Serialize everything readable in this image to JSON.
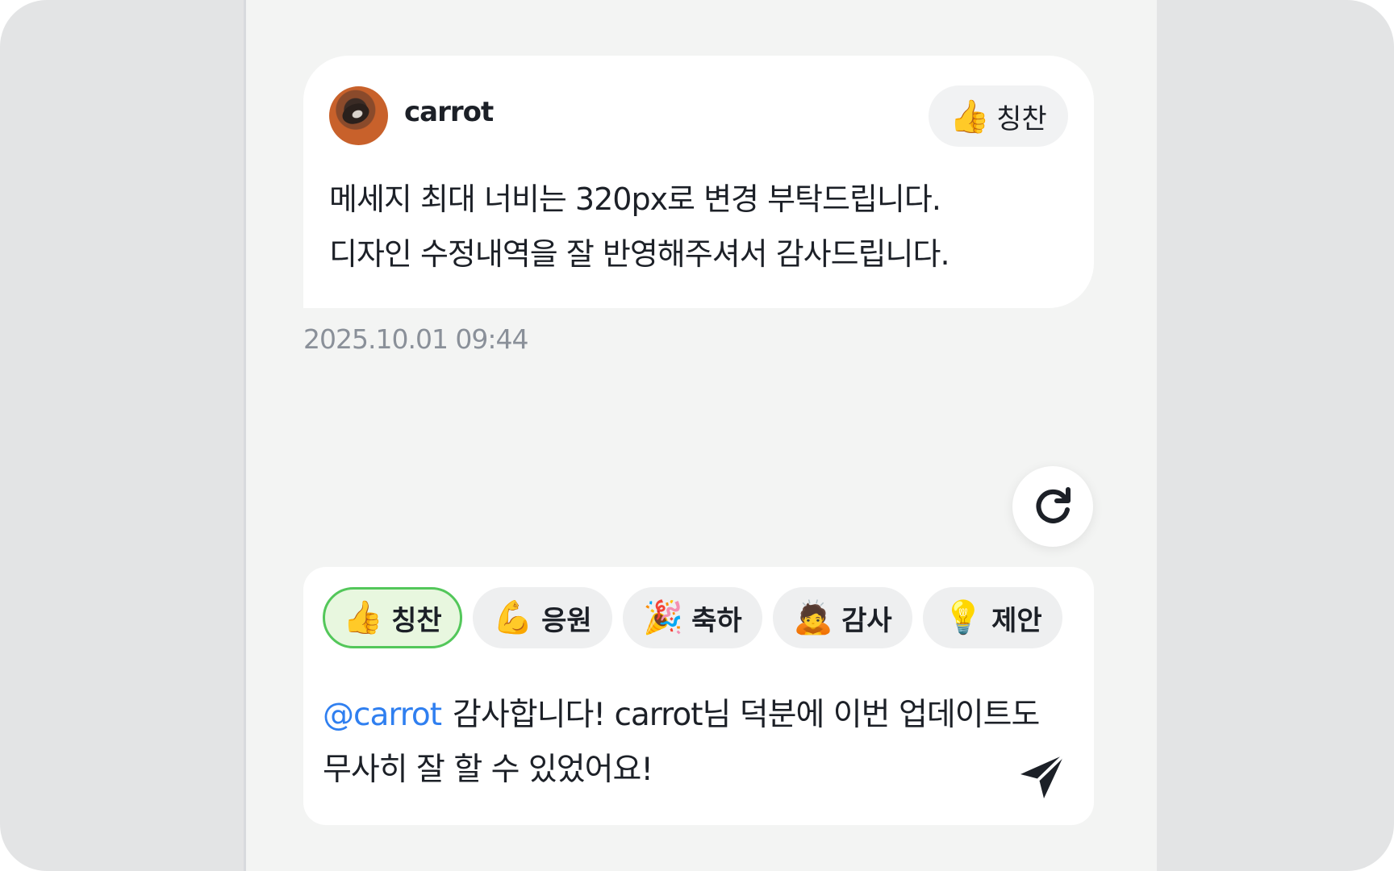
{
  "message": {
    "username": "carrot",
    "tag": {
      "icon": "thumbs-up-icon",
      "glyph": "👍",
      "label": "칭찬"
    },
    "lines": [
      "메세지 최대 너비는 320px로 변경 부탁드립니다.",
      "디자인 수정내역을 잘 반영해주셔서 감사드립니다."
    ],
    "timestamp": "2025.10.01 09:44"
  },
  "refresh": {
    "icon": "refresh-icon"
  },
  "composer": {
    "chips": [
      {
        "icon": "thumbs-up-icon",
        "glyph": "👍",
        "label": "칭찬",
        "selected": true
      },
      {
        "icon": "flexed-biceps-icon",
        "glyph": "💪",
        "label": "응원",
        "selected": false
      },
      {
        "icon": "party-popper-icon",
        "glyph": "🎉",
        "label": "축하",
        "selected": false
      },
      {
        "icon": "bowing-person-icon",
        "glyph": "🙇",
        "label": "감사",
        "selected": false
      },
      {
        "icon": "light-bulb-icon",
        "glyph": "💡",
        "label": "제안",
        "selected": false
      }
    ],
    "mention": "@carrot",
    "text": "감사합니다! carrot님 덕분에 이번 업데이트도 무사히 잘 할 수 있었어요!",
    "send_icon": "send-icon"
  },
  "colors": {
    "accent_green": "#53c75a",
    "mention_blue": "#2f7ff0",
    "timestamp_gray": "#8a9099",
    "panel_bg": "#f3f4f3"
  }
}
